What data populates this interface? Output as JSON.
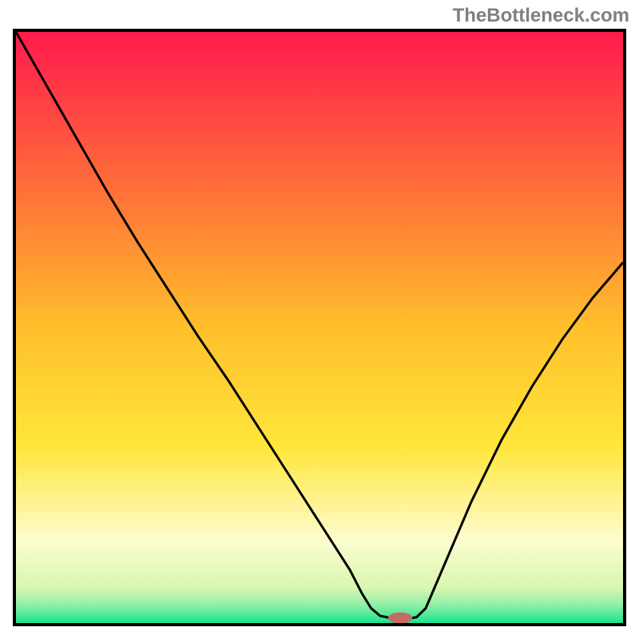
{
  "watermark": "TheBottleneck.com",
  "chart_data": {
    "type": "line",
    "xlim": [
      0,
      100
    ],
    "ylim": [
      0,
      100
    ],
    "grid": false,
    "title": "",
    "xlabel": "",
    "ylabel": "",
    "background_gradient_stops": [
      {
        "offset": 0.0,
        "color": "#ff1a4d"
      },
      {
        "offset": 0.25,
        "color": "#ff6a3a"
      },
      {
        "offset": 0.5,
        "color": "#ffbf2b"
      },
      {
        "offset": 0.7,
        "color": "#ffe63a"
      },
      {
        "offset": 0.86,
        "color": "#fdfccf"
      },
      {
        "offset": 0.94,
        "color": "#d9f7b2"
      },
      {
        "offset": 0.97,
        "color": "#8df0a6"
      },
      {
        "offset": 1.0,
        "color": "#18e48e"
      }
    ],
    "series": [
      {
        "name": "curve",
        "stroke": "#000000",
        "points": [
          [
            0,
            100
          ],
          [
            5,
            91
          ],
          [
            10,
            82
          ],
          [
            15,
            73
          ],
          [
            20,
            64.5
          ],
          [
            25,
            56.5
          ],
          [
            30,
            48.5
          ],
          [
            35,
            41
          ],
          [
            40,
            33
          ],
          [
            45,
            25
          ],
          [
            50,
            17
          ],
          [
            55,
            9
          ],
          [
            57,
            5
          ],
          [
            58.5,
            2.5
          ],
          [
            60,
            1.2
          ],
          [
            62,
            0.8
          ],
          [
            63,
            0.9
          ],
          [
            65,
            0.8
          ],
          [
            66,
            1.0
          ],
          [
            67.5,
            2.5
          ],
          [
            70,
            8.5
          ],
          [
            75,
            20.5
          ],
          [
            80,
            31
          ],
          [
            85,
            40
          ],
          [
            90,
            48
          ],
          [
            95,
            55
          ],
          [
            100,
            61
          ]
        ]
      }
    ],
    "marker": {
      "name": "pill-marker",
      "cx": 63.3,
      "cy": 0.85,
      "rx": 2.0,
      "ry": 0.95,
      "fill": "#c56b66"
    }
  }
}
